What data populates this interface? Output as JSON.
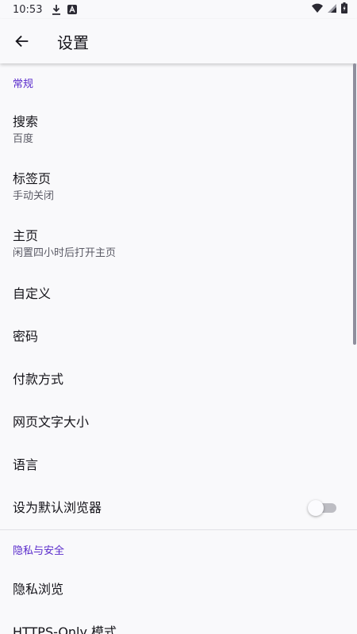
{
  "status_bar": {
    "time": "10:53"
  },
  "header": {
    "title": "设置"
  },
  "sections": {
    "general": {
      "title": "常规",
      "search": {
        "label": "搜索",
        "summary": "百度"
      },
      "tabs": {
        "label": "标签页",
        "summary": "手动关闭"
      },
      "homepage": {
        "label": "主页",
        "summary": "闲置四小时后打开主页"
      },
      "customize": {
        "label": "自定义"
      },
      "passwords": {
        "label": "密码"
      },
      "payment": {
        "label": "付款方式"
      },
      "font_size": {
        "label": "网页文字大小"
      },
      "language": {
        "label": "语言"
      },
      "default_browser": {
        "label": "设为默认浏览器",
        "enabled": false
      }
    },
    "privacy": {
      "title": "隐私与安全",
      "private_browsing": {
        "label": "隐私浏览"
      },
      "https_only": {
        "label": "HTTPS-Only 模式"
      }
    }
  },
  "colors": {
    "accent": "#592acb",
    "background": "#f9f9fb"
  }
}
